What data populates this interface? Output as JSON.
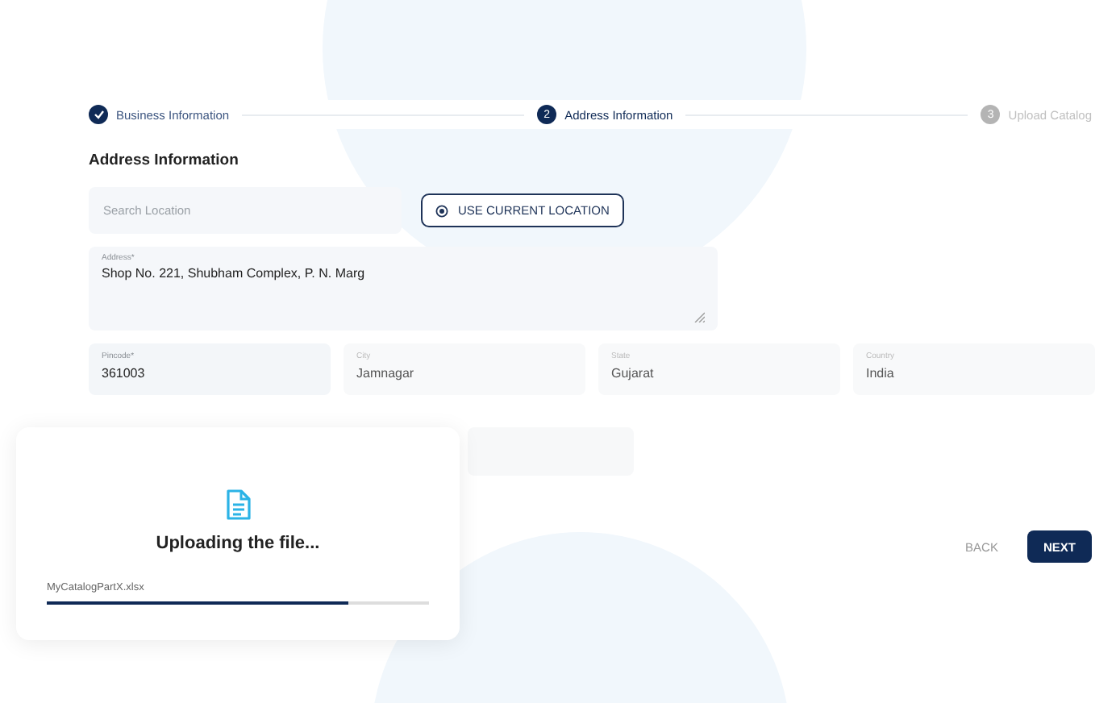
{
  "stepper": [
    {
      "label": "Business Information",
      "completed": true,
      "selected": false
    },
    {
      "label": "Address Information",
      "number": "2",
      "completed": false,
      "selected": true
    },
    {
      "label": "Upload Catalog",
      "number": "3",
      "completed": false,
      "selected": false
    }
  ],
  "section_title": "Address Information",
  "search": {
    "placeholder": "Search Location"
  },
  "location_button": "USE CURRENT LOCATION",
  "address": {
    "label": "Address*",
    "value": "Shop No. 221, Shubham Complex, P. N. Marg"
  },
  "fields": [
    {
      "label": "Pincode*",
      "value": "361003",
      "disabled": false
    },
    {
      "label": "City",
      "value": "Jamnagar",
      "disabled": true
    },
    {
      "label": "State",
      "value": "Gujarat",
      "disabled": true
    },
    {
      "label": "Country",
      "value": "India",
      "disabled": true
    }
  ],
  "actions": {
    "back": "BACK",
    "next": "NEXT"
  },
  "upload": {
    "title": "Uploading the file...",
    "file_name": "MyCatalogPartX.xlsx",
    "level": 0.79
  }
}
